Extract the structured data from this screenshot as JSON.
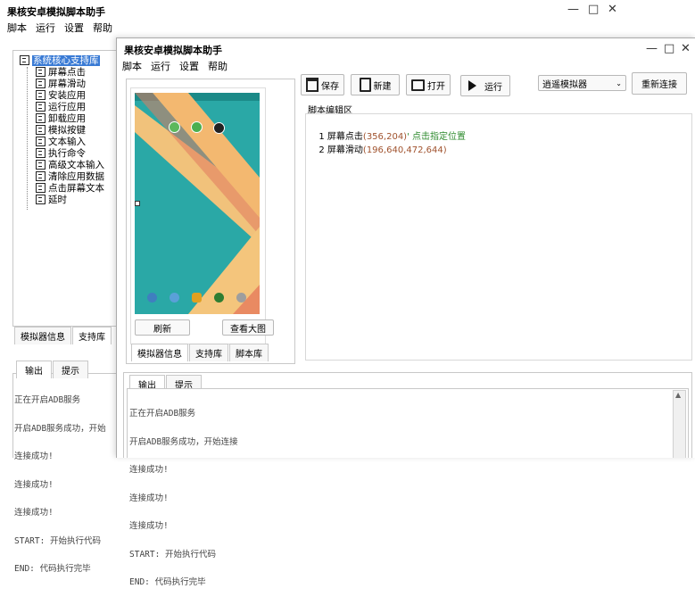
{
  "back_window": {
    "title": "果核安卓模拟脚本助手",
    "menu": [
      "脚本",
      "运行",
      "设置",
      "帮助"
    ],
    "controls": [
      "—",
      "□",
      "✕"
    ],
    "tree": {
      "root": "系统核心支持库",
      "items": [
        "屏幕点击",
        "屏幕滑动",
        "安装应用",
        "运行应用",
        "卸载应用",
        "模拟按键",
        "文本输入",
        "执行命令",
        "高级文本输入",
        "清除应用数据",
        "点击屏幕文本",
        "延时"
      ]
    },
    "tabs": [
      "模拟器信息",
      "支持库"
    ],
    "output_tabs": [
      "输出",
      "提示"
    ],
    "log": [
      "正在开启ADB服务",
      "开启ADB服务成功，开始",
      "连接成功!",
      "连接成功!",
      "连接成功!",
      "START: 开始执行代码",
      "END: 代码执行完毕"
    ]
  },
  "front_window": {
    "title": "果核安卓模拟脚本助手",
    "menu": [
      "脚本",
      "运行",
      "设置",
      "帮助"
    ],
    "controls": [
      "—",
      "□",
      "✕"
    ],
    "toolbar": {
      "save": "保存",
      "new": "新建",
      "open": "打开",
      "run": "运行"
    },
    "emulator_select": "逍遥模拟器",
    "reconnect": "重新连接",
    "editor_title": "脚本编辑区",
    "code_lines": [
      {
        "num": "1",
        "fn": "屏幕点击",
        "args": "(356,204)",
        "comment": "' 点击指定位置"
      },
      {
        "num": "2",
        "fn": "屏幕滑动",
        "args": "(196,640,472,644)",
        "comment": ""
      }
    ],
    "refresh": "刷新",
    "view_large": "查看大图",
    "tabs": [
      "模拟器信息",
      "支持库",
      "脚本库"
    ],
    "output_tabs": [
      "输出",
      "提示"
    ],
    "log": [
      "正在开启ADB服务",
      "开启ADB服务成功，开始连接",
      "连接成功!",
      "连接成功!",
      "连接成功!",
      "START: 开始执行代码",
      "END: 代码执行完毕"
    ]
  }
}
